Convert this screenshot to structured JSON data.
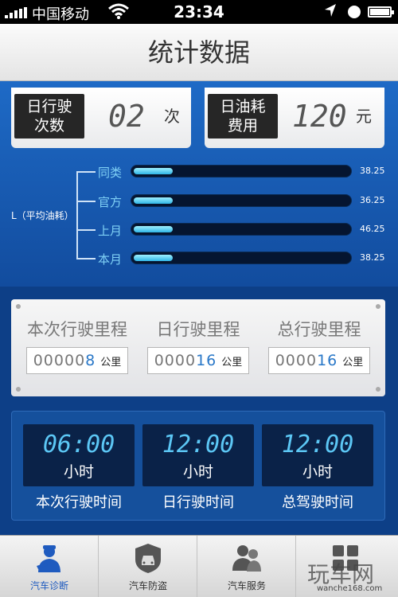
{
  "status_bar": {
    "carrier": "中国移动",
    "time": "23:34"
  },
  "header": {
    "title": "统计数据"
  },
  "stats": [
    {
      "label_line1": "日行驶",
      "label_line2": "次数",
      "value": "02",
      "unit": "次"
    },
    {
      "label_line1": "日油耗",
      "label_line2": "费用",
      "value": "120",
      "unit": "元"
    }
  ],
  "fuel_chart": {
    "axis_label": "L（平均油耗）",
    "max": 100,
    "bars": [
      {
        "name": "同类",
        "value": "38.25",
        "fill": 0.18
      },
      {
        "name": "官方",
        "value": "36.25",
        "fill": 0.18
      },
      {
        "name": "上月",
        "value": "46.25",
        "fill": 0.18
      },
      {
        "name": "本月",
        "value": "38.25",
        "fill": 0.18
      }
    ]
  },
  "mileage": [
    {
      "title": "本次行驶里程",
      "value_dim": "00000",
      "value_highlight": "8",
      "unit": "公里"
    },
    {
      "title": "日行驶里程",
      "value_dim": "0000",
      "value_highlight": "16",
      "unit": "公里"
    },
    {
      "title": "总行驶里程",
      "value_dim": "0000",
      "value_highlight": "16",
      "unit": "公里"
    }
  ],
  "times": [
    {
      "value": "06:00",
      "unit": "小时",
      "label": "本次行驶时间"
    },
    {
      "value": "12:00",
      "unit": "小时",
      "label": "日行驶时间"
    },
    {
      "value": "12:00",
      "unit": "小时",
      "label": "总驾驶时间"
    }
  ],
  "tabs": [
    {
      "label": "汽车诊断",
      "icon": "mechanic-icon",
      "active": true,
      "color": "#1f5bbf"
    },
    {
      "label": "汽车防盗",
      "icon": "car-shield-icon",
      "active": false,
      "color": "#555555"
    },
    {
      "label": "汽车服务",
      "icon": "people-icon",
      "active": false,
      "color": "#555555"
    },
    {
      "label": "",
      "icon": "grid-icon",
      "active": false,
      "color": "#555555"
    }
  ],
  "watermark": {
    "text": "玩车网",
    "url": "wanche168.com"
  }
}
